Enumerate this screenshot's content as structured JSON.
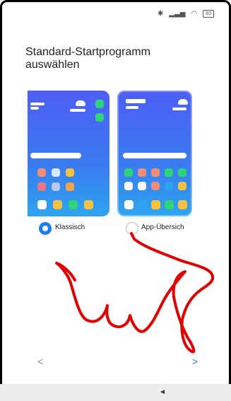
{
  "status_bar": {
    "icons": [
      "bluetooth-icon",
      "signal-icon",
      "wifi-icon",
      "battery-icon"
    ],
    "battery_text": "83"
  },
  "title": "Standard-Startprogramm auswählen",
  "options": [
    {
      "label": "Klassisch",
      "selected": true
    },
    {
      "label": "App-Übersich",
      "selected": false
    }
  ],
  "nav": {
    "prev": "<",
    "next": ">"
  },
  "navbar": {
    "back": "◄"
  },
  "colors": {
    "accent": "#1a7cf0",
    "card_gradient_top": "#4d5ef5",
    "card_gradient_bottom": "#2ea4ee",
    "scribble": "#e10000"
  },
  "preview_classic": {
    "grid_colors": [
      "#f28d7b",
      "#dbe6ff",
      "#f6c13e",
      "#e97786",
      "#b9c9f3",
      "#f7a24a"
    ],
    "dock_colors": [
      "#ffffff",
      "#f6c13e",
      "#2fd47a",
      "#f6c13e"
    ]
  },
  "preview_overview": {
    "grid_colors": [
      "#2fd47a",
      "#f28d7b",
      "#f28d7b",
      "#2fd47a",
      "#2fd47a",
      "#ffffff",
      "#ffffff",
      "#f28d7b",
      "#2ea4ee",
      "#f6c13e"
    ],
    "dock_colors": [
      "#ffffff",
      "#2ea4ee",
      "#f6c13e",
      "#2fd47a",
      "#f6c13e"
    ]
  }
}
